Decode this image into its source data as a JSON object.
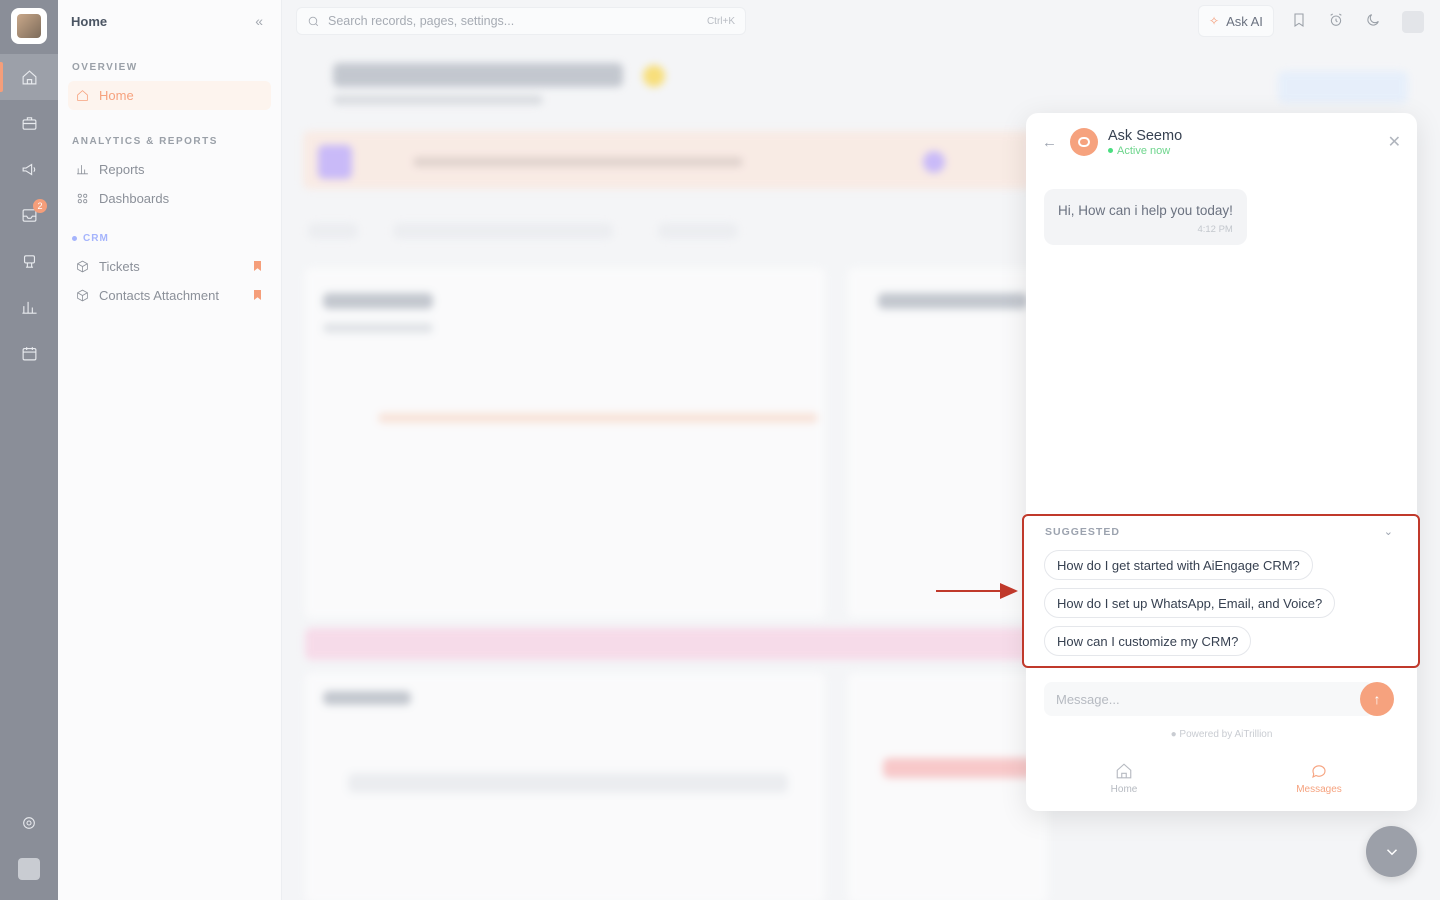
{
  "sidebar": {
    "title": "Home",
    "sections": {
      "overview": "OVERVIEW",
      "analytics": "ANALYTICS & REPORTS",
      "crm": "CRM"
    },
    "items": {
      "home": "Home",
      "reports": "Reports",
      "dashboards": "Dashboards",
      "tickets": "Tickets",
      "contacts_attachment": "Contacts Attachment"
    }
  },
  "rail": {
    "inbox_badge": "2"
  },
  "topbar": {
    "search_placeholder": "Search records, pages, settings...",
    "search_shortcut": "Ctrl+K",
    "ask_ai_label": "Ask AI"
  },
  "chat": {
    "bot_name": "Ask Seemo",
    "status": "Active now",
    "greeting": "Hi, How can i help you today!",
    "greeting_time": "4:12 PM",
    "suggested_title": "SUGGESTED",
    "suggestions": [
      "How do I get started with AiEngage CRM?",
      "How do I set up WhatsApp, Email, and Voice?",
      "How can I customize my CRM?"
    ],
    "message_placeholder": "Message...",
    "powered_by": "Powered by AiTrillion",
    "nav_home": "Home",
    "nav_messages": "Messages"
  },
  "colors": {
    "accent": "#f6a27e",
    "highlight_border": "#c0392b",
    "rail_bg": "#8a8e98"
  }
}
